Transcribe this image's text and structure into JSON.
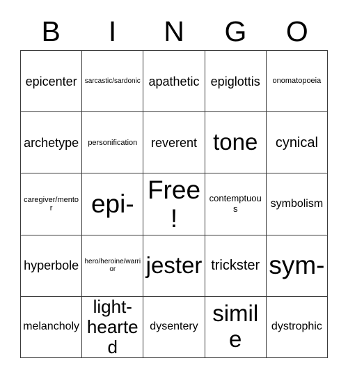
{
  "card": {
    "title": "BINGO",
    "header_letters": [
      "B",
      "I",
      "N",
      "G",
      "O"
    ],
    "free_space_label": "Free!",
    "colors": {
      "background": "#ffffff",
      "text": "#000000",
      "grid_line": "#3b3b3b"
    },
    "grid": {
      "rows": 5,
      "columns": 5,
      "cells": [
        [
          {
            "text": "epicenter",
            "size": "s-mdl"
          },
          {
            "text": "sarcastic/sardonic",
            "size": "s-xs"
          },
          {
            "text": "apathetic",
            "size": "s-mdl"
          },
          {
            "text": "epiglottis",
            "size": "s-mdl"
          },
          {
            "text": "onomatopoeia",
            "size": "s-sm"
          }
        ],
        [
          {
            "text": "archetype",
            "size": "s-mdl"
          },
          {
            "text": "personification",
            "size": "s-sm"
          },
          {
            "text": "reverent",
            "size": "s-mdl"
          },
          {
            "text": "tone",
            "size": "s-xxl"
          },
          {
            "text": "cynical",
            "size": "s-lg"
          }
        ],
        [
          {
            "text": "caregiver/mentor",
            "size": "s-sm"
          },
          {
            "text": "epi-",
            "size": "s-huge"
          },
          {
            "text": "Free!",
            "size": "s-huge"
          },
          {
            "text": "contemptuous",
            "size": "s-smm"
          },
          {
            "text": "symbolism",
            "size": "s-md"
          }
        ],
        [
          {
            "text": "hyperbole",
            "size": "s-mdl"
          },
          {
            "text": "hero/heroine/warrior",
            "size": "s-xs"
          },
          {
            "text": "jester",
            "size": "s-xxl"
          },
          {
            "text": "trickster",
            "size": "s-lg"
          },
          {
            "text": "sym-",
            "size": "s-huge"
          }
        ],
        [
          {
            "text": "melancholy",
            "size": "s-md"
          },
          {
            "text": "light-hearted",
            "size": "s-xl"
          },
          {
            "text": "dysentery",
            "size": "s-md"
          },
          {
            "text": "simile",
            "size": "s-xxl"
          },
          {
            "text": "dystrophic",
            "size": "s-md"
          }
        ]
      ]
    }
  }
}
